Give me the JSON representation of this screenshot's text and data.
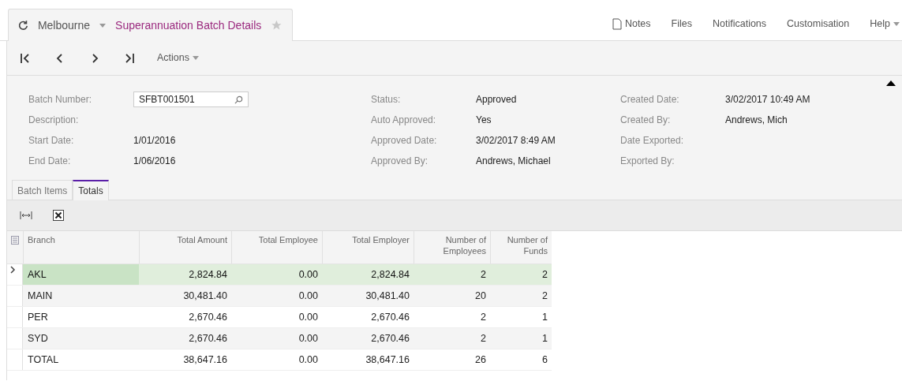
{
  "header": {
    "company": "Melbourne",
    "title": "Superannuation Batch Details",
    "favorite": false
  },
  "top_links": [
    {
      "label": "Notes",
      "kind": "note"
    },
    {
      "label": "Files",
      "kind": "plain"
    },
    {
      "label": "Notifications",
      "kind": "plain"
    },
    {
      "label": "Customisation",
      "kind": "plain"
    },
    {
      "label": "Help",
      "kind": "menu"
    }
  ],
  "toolbar": {
    "actions": "Actions"
  },
  "form": {
    "columns": [
      [
        {
          "label": "Batch Number:",
          "value": "SFBT001501",
          "kind": "lookup"
        },
        {
          "label": "Description:",
          "kind": "text"
        },
        {
          "label": "Start Date:",
          "value": "1/01/2016",
          "kind": "text"
        },
        {
          "label": "End Date:",
          "value": "1/06/2016",
          "kind": "text"
        }
      ],
      [
        {
          "label": "Status:",
          "value": "Approved",
          "kind": "text"
        },
        {
          "label": "Auto Approved:",
          "value": "Yes",
          "kind": "text"
        },
        {
          "label": "Approved Date:",
          "value": "3/02/2017 8:49 AM",
          "kind": "text"
        },
        {
          "label": "Approved By:",
          "value": "Andrews, Michael",
          "kind": "text"
        }
      ],
      [
        {
          "label": "Created Date:",
          "value": "3/02/2017 10:49 AM",
          "kind": "text"
        },
        {
          "label": "Created By:",
          "value": "Andrews, Mich",
          "kind": "text"
        },
        {
          "label": "Date Exported:",
          "kind": "text"
        },
        {
          "label": "Exported By:",
          "kind": "text"
        }
      ]
    ]
  },
  "tabs": [
    {
      "label": "Batch Items",
      "selected": false
    },
    {
      "label": "Totals",
      "selected": true
    }
  ],
  "table": {
    "columns": [
      "Branch",
      "Total Amount",
      "Total Employee",
      "Total Employer",
      "Number of Employees",
      "Number of Funds"
    ],
    "rows": [
      {
        "selected": true,
        "cells": [
          "AKL",
          "2,824.84",
          "0.00",
          "2,824.84",
          "2",
          "2"
        ]
      },
      {
        "selected": false,
        "cells": [
          "MAIN",
          "30,481.40",
          "0.00",
          "30,481.40",
          "20",
          "2"
        ]
      },
      {
        "selected": false,
        "cells": [
          "PER",
          "2,670.46",
          "0.00",
          "2,670.46",
          "2",
          "1"
        ]
      },
      {
        "selected": false,
        "cells": [
          "SYD",
          "2,670.46",
          "0.00",
          "2,670.46",
          "2",
          "1"
        ]
      },
      {
        "selected": false,
        "cells": [
          "TOTAL",
          "38,647.16",
          "0.00",
          "38,647.16",
          "26",
          "6"
        ]
      }
    ]
  }
}
